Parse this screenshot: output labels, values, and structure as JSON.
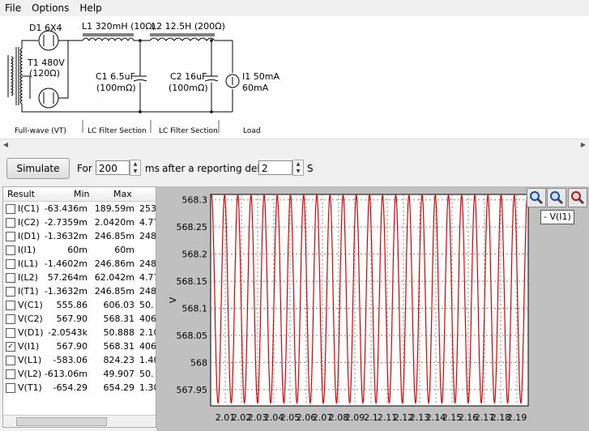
{
  "menu": [
    "File",
    "Options",
    "Help"
  ],
  "schematic": {
    "d1": "D1 6X4",
    "t1_a": "T1 480V",
    "t1_b": "(120Ω)",
    "l1": "L1 320mH (10Ω)",
    "l2": "L2 12.5H (200Ω)",
    "c1_a": "C1 6.5uF",
    "c1_b": "(100mΩ)",
    "c2_a": "C2 16uF",
    "c2_b": "(100mΩ)",
    "i1_a": "I1 50mA",
    "i1_b": "60mA",
    "sec_fullwave": "Full-wave (VT)",
    "sec_lc1": "LC Filter Section",
    "sec_lc2": "LC Filter Section",
    "sec_load": "Load"
  },
  "controls": {
    "simulate": "Simulate",
    "for": "For",
    "duration": "200",
    "ms": "ms",
    "after": "after a reporting delay of",
    "delay": "2",
    "s": "S"
  },
  "table": {
    "headers": {
      "result": "Result",
      "min": "Min",
      "max": "Max"
    },
    "rows": [
      {
        "name": "I(C1)",
        "min": "-63.436m",
        "max": "189.59m",
        "extra": "253.",
        "checked": false
      },
      {
        "name": "I(C2)",
        "min": "-2.7359m",
        "max": "2.0420m",
        "extra": "4.77",
        "checked": false
      },
      {
        "name": "I(D1)",
        "min": "-1.3632m",
        "max": "246.85m",
        "extra": "248.",
        "checked": false
      },
      {
        "name": "I(I1)",
        "min": "60m",
        "max": "60m",
        "extra": "",
        "checked": false
      },
      {
        "name": "I(L1)",
        "min": "-1.4602m",
        "max": "246.86m",
        "extra": "248.",
        "checked": false
      },
      {
        "name": "I(L2)",
        "min": "57.264m",
        "max": "62.042m",
        "extra": "4.77",
        "checked": false
      },
      {
        "name": "I(T1)",
        "min": "-1.3632m",
        "max": "246.85m",
        "extra": "248.",
        "checked": false
      },
      {
        "name": "V(C1)",
        "min": "555.86",
        "max": "606.03",
        "extra": "50.",
        "checked": false
      },
      {
        "name": "V(C2)",
        "min": "567.90",
        "max": "568.31",
        "extra": "406.",
        "checked": false
      },
      {
        "name": "V(D1)",
        "min": "-2.0543k",
        "max": "50.888",
        "extra": "2.10",
        "checked": false
      },
      {
        "name": "V(I1)",
        "min": "567.90",
        "max": "568.31",
        "extra": "406.",
        "checked": true
      },
      {
        "name": "V(L1)",
        "min": "-583.06",
        "max": "824.23",
        "extra": "1.40",
        "checked": false
      },
      {
        "name": "V(L2)",
        "min": "-613.06m",
        "max": "49.907",
        "extra": "50.",
        "checked": false
      },
      {
        "name": "V(T1)",
        "min": "-654.29",
        "max": "654.29",
        "extra": "1.30",
        "checked": false
      }
    ]
  },
  "tooltip": "- V(I1)",
  "chart_data": {
    "type": "line",
    "series": [
      {
        "name": "V(I1)",
        "color": "#e00000"
      }
    ],
    "ylabel": "V",
    "ylim": [
      567.92,
      568.31
    ],
    "yticks": [
      "568.3",
      "568.25",
      "568.2",
      "568.15",
      "568.1",
      "568.05",
      "568",
      "567.95"
    ],
    "xticks": [
      "2.01",
      "2.02",
      "2.03",
      "2.04",
      "2.05",
      "2.06",
      "2.07",
      "2.08",
      "2.09",
      "2.1",
      "2.11",
      "2.12",
      "2.13",
      "2.14",
      "2.15",
      "2.16",
      "2.17",
      "2.18",
      "2.19"
    ],
    "cycles": 24,
    "ymin_value": 567.9,
    "ymax_value": 568.31,
    "grid": true
  }
}
